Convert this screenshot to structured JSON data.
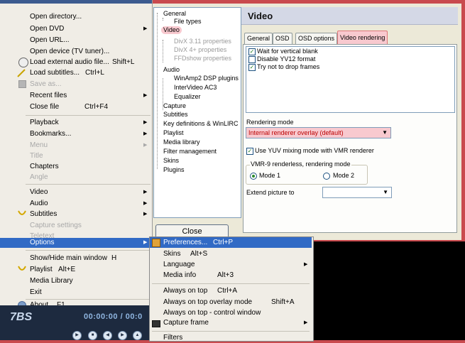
{
  "context_menu": {
    "items": [
      {
        "label": "Open directory...",
        "shortcut": "",
        "submenu": false,
        "disabled": false
      },
      {
        "label": "Open DVD",
        "shortcut": "",
        "submenu": true,
        "disabled": false
      },
      {
        "label": "Open URL...",
        "shortcut": "",
        "submenu": false,
        "disabled": false
      },
      {
        "label": "Open device (TV tuner)...",
        "shortcut": "",
        "submenu": false,
        "disabled": false
      },
      {
        "label": "Load external audio file...",
        "shortcut": "Shift+L",
        "submenu": false,
        "disabled": false
      },
      {
        "label": "Load subtitles...",
        "shortcut": "Ctrl+L",
        "submenu": false,
        "disabled": false
      },
      {
        "label": "Save as...",
        "shortcut": "",
        "submenu": false,
        "disabled": true
      },
      {
        "label": "Recent files",
        "shortcut": "",
        "submenu": true,
        "disabled": false
      },
      {
        "label": "Close file",
        "shortcut": "Ctrl+F4",
        "submenu": false,
        "disabled": false
      },
      {
        "label": "Playback",
        "shortcut": "",
        "submenu": true,
        "disabled": false
      },
      {
        "label": "Bookmarks...",
        "shortcut": "",
        "submenu": true,
        "disabled": false
      },
      {
        "label": "Menu",
        "shortcut": "",
        "submenu": true,
        "disabled": true
      },
      {
        "label": "Title",
        "shortcut": "",
        "submenu": false,
        "disabled": true
      },
      {
        "label": "Chapters",
        "shortcut": "",
        "submenu": false,
        "disabled": false
      },
      {
        "label": "Angle",
        "shortcut": "",
        "submenu": false,
        "disabled": true
      },
      {
        "label": "Video",
        "shortcut": "",
        "submenu": true,
        "disabled": false
      },
      {
        "label": "Audio",
        "shortcut": "",
        "submenu": true,
        "disabled": false
      },
      {
        "label": "Subtitles",
        "shortcut": "",
        "submenu": true,
        "disabled": false
      },
      {
        "label": "Capture settings",
        "shortcut": "",
        "submenu": false,
        "disabled": true
      },
      {
        "label": "Teletext",
        "shortcut": "",
        "submenu": false,
        "disabled": true
      },
      {
        "label": "Options",
        "shortcut": "",
        "submenu": true,
        "disabled": false
      },
      {
        "label": "Show/Hide main window",
        "shortcut": "H",
        "submenu": false,
        "disabled": false
      },
      {
        "label": "Playlist",
        "shortcut": "Alt+E",
        "submenu": false,
        "disabled": false
      },
      {
        "label": "Media Library",
        "shortcut": "",
        "submenu": false,
        "disabled": false
      },
      {
        "label": "Exit",
        "shortcut": "",
        "submenu": false,
        "disabled": false
      },
      {
        "label": "About",
        "shortcut": "F1",
        "submenu": false,
        "disabled": false
      }
    ]
  },
  "options_submenu": {
    "items": [
      {
        "label": "Preferences...",
        "shortcut": "Ctrl+P"
      },
      {
        "label": "Skins",
        "shortcut": "Alt+S"
      },
      {
        "label": "Language",
        "shortcut": ""
      },
      {
        "label": "Media info",
        "shortcut": "Alt+3"
      },
      {
        "label": "Always on top",
        "shortcut": "Ctrl+A"
      },
      {
        "label": "Always on top overlay mode",
        "shortcut": "Shift+A"
      },
      {
        "label": "Always on top - control window",
        "shortcut": ""
      },
      {
        "label": "Capture frame",
        "shortcut": ""
      },
      {
        "label": "Filters",
        "shortcut": ""
      }
    ]
  },
  "tree": {
    "items": [
      {
        "label": "General",
        "level": 0,
        "dim": false,
        "selected": false
      },
      {
        "label": "File types",
        "level": 1,
        "dim": false,
        "selected": false
      },
      {
        "label": "Video",
        "level": 0,
        "dim": false,
        "selected": true
      },
      {
        "label": "DivX 3.11 properties",
        "level": 1,
        "dim": true,
        "selected": false
      },
      {
        "label": "DivX 4+ properties",
        "level": 1,
        "dim": true,
        "selected": false
      },
      {
        "label": "FFDshow properties",
        "level": 1,
        "dim": true,
        "selected": false
      },
      {
        "label": "Audio",
        "level": 0,
        "dim": false,
        "selected": false
      },
      {
        "label": "WinAmp2 DSP plugins",
        "level": 1,
        "dim": false,
        "selected": false
      },
      {
        "label": "InterVideo AC3",
        "level": 1,
        "dim": false,
        "selected": false
      },
      {
        "label": "Equalizer",
        "level": 1,
        "dim": false,
        "selected": false
      },
      {
        "label": "Capture",
        "level": 0,
        "dim": false,
        "selected": false
      },
      {
        "label": "Subtitles",
        "level": 0,
        "dim": false,
        "selected": false
      },
      {
        "label": "Key definitions & WinLIRC",
        "level": 0,
        "dim": false,
        "selected": false
      },
      {
        "label": "Playlist",
        "level": 0,
        "dim": false,
        "selected": false
      },
      {
        "label": "Media library",
        "level": 0,
        "dim": false,
        "selected": false
      },
      {
        "label": "Filter management",
        "level": 0,
        "dim": false,
        "selected": false
      },
      {
        "label": "Skins",
        "level": 0,
        "dim": false,
        "selected": false
      },
      {
        "label": "Plugins",
        "level": 0,
        "dim": false,
        "selected": false
      }
    ],
    "close_label": "Close"
  },
  "video_panel": {
    "title": "Video",
    "tabs": [
      {
        "label": "General",
        "active": false
      },
      {
        "label": "OSD",
        "active": false
      },
      {
        "label": "OSD options",
        "active": false
      },
      {
        "label": "Video rendering",
        "active": true
      }
    ],
    "checks": [
      {
        "label": "Wait for vertical blank",
        "checked": true
      },
      {
        "label": "Disable YV12 format",
        "checked": false
      },
      {
        "label": "Try not to drop frames",
        "checked": true
      }
    ],
    "rendering_mode_label": "Rendering mode",
    "rendering_mode_value": "Internal renderer overlay (default)",
    "yuv_label": "Use YUV mixing mode with VMR renderer",
    "yuv_checked": true,
    "vmr_group_label": "VMR-9 renderless, rendering mode",
    "mode1_label": "Mode 1",
    "mode2_label": "Mode 2",
    "extend_label": "Extend picture to",
    "extend_value": ""
  },
  "player": {
    "time": "00:00:00 / 00:0",
    "logo": "7BS"
  },
  "colors": {
    "menu_highlight": "#316ac5",
    "selection_pink": "#f8c9cf",
    "background": "#c94a4e"
  }
}
